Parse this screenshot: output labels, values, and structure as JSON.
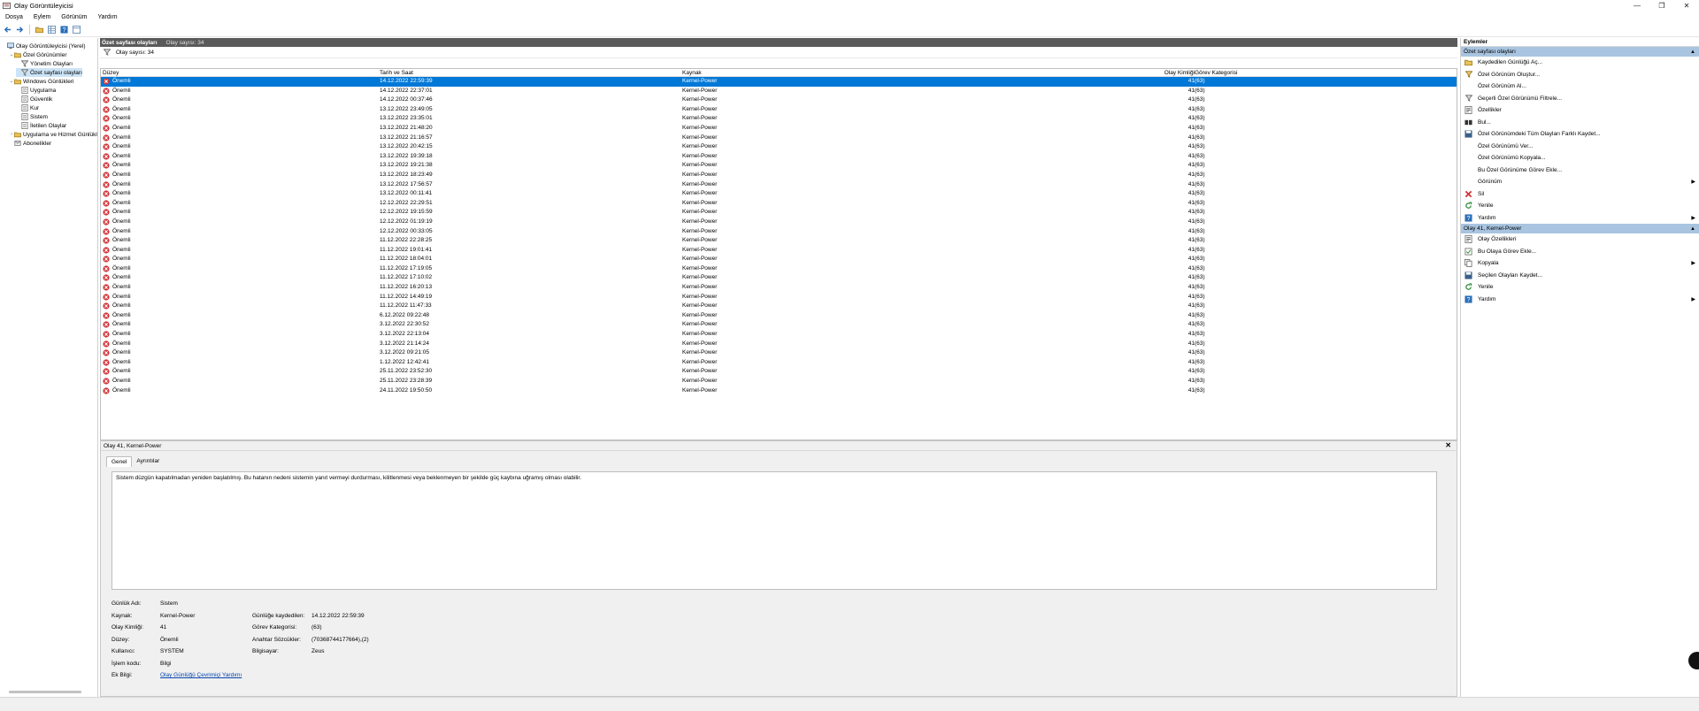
{
  "window": {
    "title": "Olay Görüntüleyicisi",
    "min": "—",
    "max": "❐",
    "close": "✕"
  },
  "menu": [
    "Dosya",
    "Eylem",
    "Görünüm",
    "Yardım"
  ],
  "tree": [
    {
      "label": "Olay Görüntüleyicisi (Yerel)",
      "indent": 0,
      "expander": "",
      "icon": "computer-icon"
    },
    {
      "label": "Özel Görünümler",
      "indent": 1,
      "expander": "⌄",
      "icon": "folder-icon"
    },
    {
      "label": "Yönetim Olayları",
      "indent": 2,
      "expander": "",
      "icon": "filter-icon"
    },
    {
      "label": "Özet sayfası olayları",
      "indent": 2,
      "expander": "",
      "icon": "filter-icon",
      "selected": true
    },
    {
      "label": "Windows Günlükleri",
      "indent": 1,
      "expander": "⌄",
      "icon": "folder-icon"
    },
    {
      "label": "Uygulama",
      "indent": 2,
      "expander": "",
      "icon": "log-icon"
    },
    {
      "label": "Güvenlik",
      "indent": 2,
      "expander": "",
      "icon": "log-icon"
    },
    {
      "label": "Kur",
      "indent": 2,
      "expander": "",
      "icon": "log-icon"
    },
    {
      "label": "Sistem",
      "indent": 2,
      "expander": "",
      "icon": "log-icon"
    },
    {
      "label": "İletilen Olaylar",
      "indent": 2,
      "expander": "",
      "icon": "log-icon"
    },
    {
      "label": "Uygulama ve Hizmet Günlükl",
      "indent": 1,
      "expander": "›",
      "icon": "folder-icon"
    },
    {
      "label": "Abonelikler",
      "indent": 1,
      "expander": "",
      "icon": "subscription-icon"
    }
  ],
  "center": {
    "header_title": "Özet sayfası olayları",
    "header_count": "Olay sayısı: 34",
    "filter_text": "Olay sayısı: 34",
    "columns": {
      "level": "Düzey",
      "date": "Tarih ve Saat",
      "source": "Kaynak",
      "id": "Olay Kimliği",
      "category": "Görev Kategorisi"
    }
  },
  "events": [
    {
      "level": "Önemli",
      "date": "14.12.2022 22:59:39",
      "source": "Kernel-Power",
      "id": "41",
      "category": "(63)"
    },
    {
      "level": "Önemli",
      "date": "14.12.2022 22:37:01",
      "source": "Kernel-Power",
      "id": "41",
      "category": "(63)"
    },
    {
      "level": "Önemli",
      "date": "14.12.2022 00:37:46",
      "source": "Kernel-Power",
      "id": "41",
      "category": "(63)"
    },
    {
      "level": "Önemli",
      "date": "13.12.2022 23:49:05",
      "source": "Kernel-Power",
      "id": "41",
      "category": "(63)"
    },
    {
      "level": "Önemli",
      "date": "13.12.2022 23:35:01",
      "source": "Kernel-Power",
      "id": "41",
      "category": "(63)"
    },
    {
      "level": "Önemli",
      "date": "13.12.2022 21:48:20",
      "source": "Kernel-Power",
      "id": "41",
      "category": "(63)"
    },
    {
      "level": "Önemli",
      "date": "13.12.2022 21:16:57",
      "source": "Kernel-Power",
      "id": "41",
      "category": "(63)"
    },
    {
      "level": "Önemli",
      "date": "13.12.2022 20:42:15",
      "source": "Kernel-Power",
      "id": "41",
      "category": "(63)"
    },
    {
      "level": "Önemli",
      "date": "13.12.2022 19:39:18",
      "source": "Kernel-Power",
      "id": "41",
      "category": "(63)"
    },
    {
      "level": "Önemli",
      "date": "13.12.2022 19:21:38",
      "source": "Kernel-Power",
      "id": "41",
      "category": "(63)"
    },
    {
      "level": "Önemli",
      "date": "13.12.2022 18:23:49",
      "source": "Kernel-Power",
      "id": "41",
      "category": "(63)"
    },
    {
      "level": "Önemli",
      "date": "13.12.2022 17:56:57",
      "source": "Kernel-Power",
      "id": "41",
      "category": "(63)"
    },
    {
      "level": "Önemli",
      "date": "13.12.2022 00:11:41",
      "source": "Kernel-Power",
      "id": "41",
      "category": "(63)"
    },
    {
      "level": "Önemli",
      "date": "12.12.2022 22:29:51",
      "source": "Kernel-Power",
      "id": "41",
      "category": "(63)"
    },
    {
      "level": "Önemli",
      "date": "12.12.2022 19:15:59",
      "source": "Kernel-Power",
      "id": "41",
      "category": "(63)"
    },
    {
      "level": "Önemli",
      "date": "12.12.2022 01:19:19",
      "source": "Kernel-Power",
      "id": "41",
      "category": "(63)"
    },
    {
      "level": "Önemli",
      "date": "12.12.2022 00:33:05",
      "source": "Kernel-Power",
      "id": "41",
      "category": "(63)"
    },
    {
      "level": "Önemli",
      "date": "11.12.2022 22:28:25",
      "source": "Kernel-Power",
      "id": "41",
      "category": "(63)"
    },
    {
      "level": "Önemli",
      "date": "11.12.2022 19:01:41",
      "source": "Kernel-Power",
      "id": "41",
      "category": "(63)"
    },
    {
      "level": "Önemli",
      "date": "11.12.2022 18:04:01",
      "source": "Kernel-Power",
      "id": "41",
      "category": "(63)"
    },
    {
      "level": "Önemli",
      "date": "11.12.2022 17:19:05",
      "source": "Kernel-Power",
      "id": "41",
      "category": "(63)"
    },
    {
      "level": "Önemli",
      "date": "11.12.2022 17:10:02",
      "source": "Kernel-Power",
      "id": "41",
      "category": "(63)"
    },
    {
      "level": "Önemli",
      "date": "11.12.2022 16:20:13",
      "source": "Kernel-Power",
      "id": "41",
      "category": "(63)"
    },
    {
      "level": "Önemli",
      "date": "11.12.2022 14:49:19",
      "source": "Kernel-Power",
      "id": "41",
      "category": "(63)"
    },
    {
      "level": "Önemli",
      "date": "11.12.2022 11:47:33",
      "source": "Kernel-Power",
      "id": "41",
      "category": "(63)"
    },
    {
      "level": "Önemli",
      "date": "6.12.2022 09:22:48",
      "source": "Kernel-Power",
      "id": "41",
      "category": "(63)"
    },
    {
      "level": "Önemli",
      "date": "3.12.2022 22:30:52",
      "source": "Kernel-Power",
      "id": "41",
      "category": "(63)"
    },
    {
      "level": "Önemli",
      "date": "3.12.2022 22:13:04",
      "source": "Kernel-Power",
      "id": "41",
      "category": "(63)"
    },
    {
      "level": "Önemli",
      "date": "3.12.2022 21:14:24",
      "source": "Kernel-Power",
      "id": "41",
      "category": "(63)"
    },
    {
      "level": "Önemli",
      "date": "3.12.2022 09:21:05",
      "source": "Kernel-Power",
      "id": "41",
      "category": "(63)"
    },
    {
      "level": "Önemli",
      "date": "1.12.2022 12:42:41",
      "source": "Kernel-Power",
      "id": "41",
      "category": "(63)"
    },
    {
      "level": "Önemli",
      "date": "25.11.2022 23:52:30",
      "source": "Kernel-Power",
      "id": "41",
      "category": "(63)"
    },
    {
      "level": "Önemli",
      "date": "25.11.2022 23:28:39",
      "source": "Kernel-Power",
      "id": "41",
      "category": "(63)"
    },
    {
      "level": "Önemli",
      "date": "24.11.2022 19:50:50",
      "source": "Kernel-Power",
      "id": "41",
      "category": "(63)"
    }
  ],
  "detail": {
    "title": "Olay 41, Kernel-Power",
    "close": "✕",
    "tabs": [
      "Genel",
      "Ayrıntılar"
    ],
    "description": "Sistem düzgün kapatılmadan yeniden başlatılmış. Bu hatanın nedeni sistemin yanıt vermeyi durdurması, kilitlenmesi veya beklenmeyen bir şekilde güç kaybına uğramış olması olabilir.",
    "fields": {
      "log_name_label": "Günlük Adı:",
      "log_name": "Sistem",
      "source_label": "Kaynak:",
      "source": "Kernel-Power",
      "logged_label": "Günlüğe kaydedilen:",
      "logged": "14.12.2022 22:59:39",
      "event_id_label": "Olay Kimliği:",
      "event_id": "41",
      "task_label": "Görev Kategorisi:",
      "task": "(63)",
      "level_label": "Düzey:",
      "level": "Önemli",
      "keywords_label": "Anahtar Sözcükler:",
      "keywords": "(70368744177664),(2)",
      "user_label": "Kullanıcı:",
      "user": "SYSTEM",
      "computer_label": "Bilgisayar:",
      "computer": "Zeus",
      "opcode_label": "İşlem kodu:",
      "opcode": "Bilgi",
      "more_label": "Ek Bilgi:",
      "more_link": "Olay Günlüğü Çevrimiçi Yardımı"
    }
  },
  "actions": {
    "title": "Eylemler",
    "section1": "Özet sayfası olayları",
    "items1": [
      {
        "label": "Kaydedilen Günlüğü Aç...",
        "icon": "open-folder-icon",
        "arrow": ""
      },
      {
        "label": "Özel Görünüm Oluştur...",
        "icon": "filter-add-icon",
        "arrow": ""
      },
      {
        "label": "Özel Görünüm Al...",
        "icon": "",
        "arrow": ""
      },
      {
        "label": "Geçerli Özel Görünümü Filtrele...",
        "icon": "filter-icon",
        "arrow": ""
      },
      {
        "label": "Özellikler",
        "icon": "properties-icon",
        "arrow": ""
      },
      {
        "label": "Bul...",
        "icon": "find-icon",
        "arrow": ""
      },
      {
        "label": "Özel Görünümdeki Tüm Olayları Farklı Kaydet...",
        "icon": "save-icon",
        "arrow": ""
      },
      {
        "label": "Özel Görünümü Ver...",
        "icon": "",
        "arrow": ""
      },
      {
        "label": "Özel Görünümü Kopyala...",
        "icon": "",
        "arrow": ""
      },
      {
        "label": "Bu Özel Görünüme Görev Ekle...",
        "icon": "",
        "arrow": ""
      },
      {
        "label": "Görünüm",
        "icon": "",
        "arrow": "▶"
      },
      {
        "label": "Sil",
        "icon": "delete-icon",
        "arrow": ""
      },
      {
        "label": "Yenile",
        "icon": "refresh-icon",
        "arrow": ""
      },
      {
        "label": "Yardım",
        "icon": "help-icon",
        "arrow": "▶"
      }
    ],
    "section2": "Olay 41, Kernel-Power",
    "items2": [
      {
        "label": "Olay Özellikleri",
        "icon": "properties-icon",
        "arrow": ""
      },
      {
        "label": "Bu Olaya Görev Ekle...",
        "icon": "task-icon",
        "arrow": ""
      },
      {
        "label": "Kopyala",
        "icon": "copy-icon",
        "arrow": "▶"
      },
      {
        "label": "Seçilen Olayları Kaydet...",
        "icon": "save-icon",
        "arrow": ""
      },
      {
        "label": "Yenile",
        "icon": "refresh-icon",
        "arrow": ""
      },
      {
        "label": "Yardım",
        "icon": "help-icon",
        "arrow": "▶"
      }
    ],
    "caret": "▲"
  },
  "colors": {
    "selection": "#0078d7",
    "section": "#a8c4e0",
    "header": "#5a5a5a",
    "error": "#d13438"
  }
}
